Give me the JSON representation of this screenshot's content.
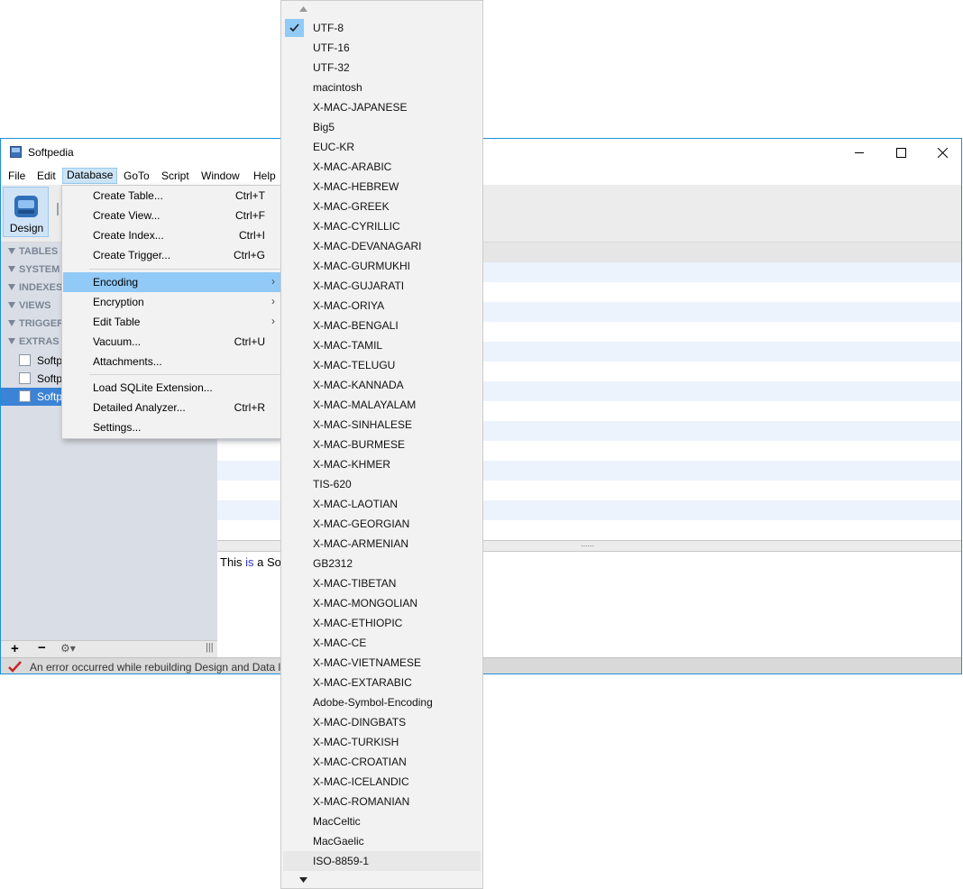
{
  "window": {
    "title": "Softpedia",
    "menus": [
      "File",
      "Edit",
      "Database",
      "GoTo",
      "Script",
      "Window",
      "Help"
    ],
    "active_menu": "Database"
  },
  "toolbar": {
    "design_label": "Design"
  },
  "sidebar": {
    "groups": [
      "TABLES",
      "SYSTEM",
      "INDEXES",
      "VIEWS",
      "TRIGGERS",
      "EXTRAS"
    ],
    "items": [
      "Softp",
      "Softp",
      "Softp"
    ],
    "selected_item": 2
  },
  "content": {
    "sql_prefix": "This ",
    "sql_keyword": "is",
    "sql_suffix": " a So"
  },
  "status": {
    "text": "An error occurred while rebuilding Design and Data li"
  },
  "database_menu": {
    "items": [
      {
        "label": "Create Table...",
        "shortcut": "Ctrl+T"
      },
      {
        "label": "Create View...",
        "shortcut": "Ctrl+F"
      },
      {
        "label": "Create Index...",
        "shortcut": "Ctrl+I"
      },
      {
        "label": "Create Trigger...",
        "shortcut": "Ctrl+G"
      },
      {
        "label": "Encoding",
        "submenu": true,
        "highlighted": true
      },
      {
        "label": "Encryption",
        "submenu": true
      },
      {
        "label": "Edit Table",
        "submenu": true
      },
      {
        "label": "Vacuum...",
        "shortcut": "Ctrl+U"
      },
      {
        "label": "Attachments...",
        "shortcut": ""
      },
      {
        "label": "Load SQLite Extension...",
        "shortcut": ""
      },
      {
        "label": "Detailed Analyzer...",
        "shortcut": "Ctrl+R"
      },
      {
        "label": "Settings...",
        "shortcut": ""
      }
    ]
  },
  "encoding_menu": {
    "checked": "UTF-8",
    "items": [
      "UTF-8",
      "UTF-16",
      "UTF-32",
      "macintosh",
      "X-MAC-JAPANESE",
      "Big5",
      "EUC-KR",
      "X-MAC-ARABIC",
      "X-MAC-HEBREW",
      "X-MAC-GREEK",
      "X-MAC-CYRILLIC",
      "X-MAC-DEVANAGARI",
      "X-MAC-GURMUKHI",
      "X-MAC-GUJARATI",
      "X-MAC-ORIYA",
      "X-MAC-BENGALI",
      "X-MAC-TAMIL",
      "X-MAC-TELUGU",
      "X-MAC-KANNADA",
      "X-MAC-MALAYALAM",
      "X-MAC-SINHALESE",
      "X-MAC-BURMESE",
      "X-MAC-KHMER",
      "TIS-620",
      "X-MAC-LAOTIAN",
      "X-MAC-GEORGIAN",
      "X-MAC-ARMENIAN",
      "GB2312",
      "X-MAC-TIBETAN",
      "X-MAC-MONGOLIAN",
      "X-MAC-ETHIOPIC",
      "X-MAC-CE",
      "X-MAC-VIETNAMESE",
      "X-MAC-EXTARABIC",
      "Adobe-Symbol-Encoding",
      "X-MAC-DINGBATS",
      "X-MAC-TURKISH",
      "X-MAC-CROATIAN",
      "X-MAC-ICELANDIC",
      "X-MAC-ROMANIAN",
      "MacCeltic",
      "MacGaelic",
      "ISO-8859-1"
    ]
  },
  "colors": {
    "accent": "#1e8fd6",
    "highlight": "#91c9f7",
    "selection": "#3b83d6"
  }
}
